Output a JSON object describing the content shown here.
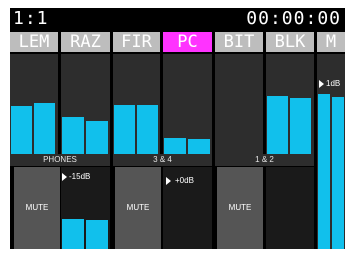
{
  "header": {
    "ratio": "1:1",
    "timecode": "00:00:00"
  },
  "tabs": [
    {
      "label": "LEM",
      "active": false
    },
    {
      "label": "RAZ",
      "active": false
    },
    {
      "label": "FIR",
      "active": false
    },
    {
      "label": "PC",
      "active": true
    },
    {
      "label": "BIT",
      "active": false
    },
    {
      "label": "BLK",
      "active": false
    },
    {
      "label": "M",
      "active": false
    }
  ],
  "groups": [
    {
      "label": "PHONES",
      "mute_label": "MUTE",
      "gain": "-15dB"
    },
    {
      "label": "3 & 4",
      "mute_label": "MUTE",
      "gain": "+0dB"
    },
    {
      "label": "1 & 2",
      "mute_label": "MUTE"
    }
  ],
  "master": {
    "gain": "1dB"
  },
  "colors": {
    "accent": "#ff33ff",
    "meter": "#11c0ec",
    "tab_bg": "#bdbdbd",
    "panel": "#2d2d2d",
    "mute_bg": "#555555"
  }
}
